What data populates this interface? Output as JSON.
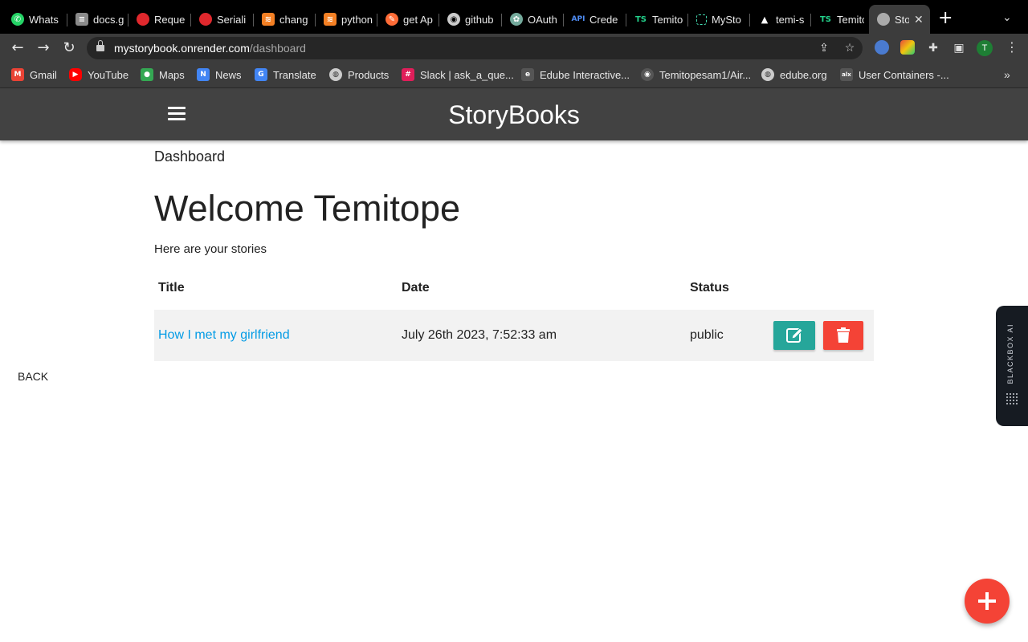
{
  "browser": {
    "tabs": [
      {
        "label": "Whats",
        "icon": "whatsapp-icon",
        "color": "#25d366"
      },
      {
        "label": "docs.g",
        "icon": "docs-icon",
        "color": "#8a8a8a"
      },
      {
        "label": "Reque",
        "icon": "postman-icon",
        "color": "#e0282d"
      },
      {
        "label": "Seriali",
        "icon": "postman-icon",
        "color": "#e0282d"
      },
      {
        "label": "chang",
        "icon": "stackoverflow-icon",
        "color": "#f48024"
      },
      {
        "label": "python",
        "icon": "stackoverflow-icon",
        "color": "#f48024"
      },
      {
        "label": "get Ap",
        "icon": "postman-icon",
        "color": "#ff6c37"
      },
      {
        "label": "github",
        "icon": "github-icon",
        "color": "#cccccc"
      },
      {
        "label": "OAuth",
        "icon": "openai-icon",
        "color": "#74aa9c"
      },
      {
        "label": "Crede",
        "icon": "api-icon",
        "color": "#4f8df5"
      },
      {
        "label": "Temito",
        "icon": "ts-icon",
        "color": "#23d18b"
      },
      {
        "label": "MySto",
        "icon": "render-icon",
        "color": "#46e3b7"
      },
      {
        "label": "temi-s",
        "icon": "vercel-icon",
        "color": "#ffffff"
      },
      {
        "label": "Temito",
        "icon": "ts-icon",
        "color": "#23d18b"
      },
      {
        "label": "Sto",
        "icon": "globe-icon",
        "color": "#aaaaaa"
      }
    ],
    "active_tab_index": 14,
    "url_host": "mystorybook.onrender.com",
    "url_path": "/dashboard",
    "profile_initial": "T",
    "bookmarks": [
      {
        "label": "Gmail",
        "icon": "gmail-icon",
        "color": "#ea4335"
      },
      {
        "label": "YouTube",
        "icon": "youtube-icon",
        "color": "#ff0000"
      },
      {
        "label": "Maps",
        "icon": "maps-icon",
        "color": "#34a853"
      },
      {
        "label": "News",
        "icon": "news-icon",
        "color": "#4285f4"
      },
      {
        "label": "Translate",
        "icon": "translate-icon",
        "color": "#4285f4"
      },
      {
        "label": "Products",
        "icon": "globe-icon",
        "color": "#cccccc"
      },
      {
        "label": "Slack | ask_a_que...",
        "icon": "slack-icon",
        "color": "#e01e5a"
      },
      {
        "label": "Edube Interactive...",
        "icon": "edube-icon",
        "color": "#555555"
      },
      {
        "label": "Temitopesam1/Air...",
        "icon": "github-icon",
        "color": "#555555"
      },
      {
        "label": "edube.org",
        "icon": "globe-icon",
        "color": "#cccccc"
      },
      {
        "label": "User Containers -...",
        "icon": "alx-icon",
        "color": "#555555"
      }
    ]
  },
  "app": {
    "brand": "StoryBooks",
    "accent_nav": "#424242",
    "breadcrumb": "Dashboard",
    "welcome": "Welcome Temitope",
    "subtitle": "Here are your stories",
    "table": {
      "headers": [
        "Title",
        "Date",
        "Status"
      ],
      "rows": [
        {
          "title": "How I met my girlfriend",
          "date": "July 26th 2023, 7:52:33 am",
          "status": "public"
        }
      ]
    },
    "back_label": "BACK",
    "edit_color": "#26a69a",
    "delete_color": "#f44336",
    "blackbox_label": "BLACKBOX AI"
  }
}
